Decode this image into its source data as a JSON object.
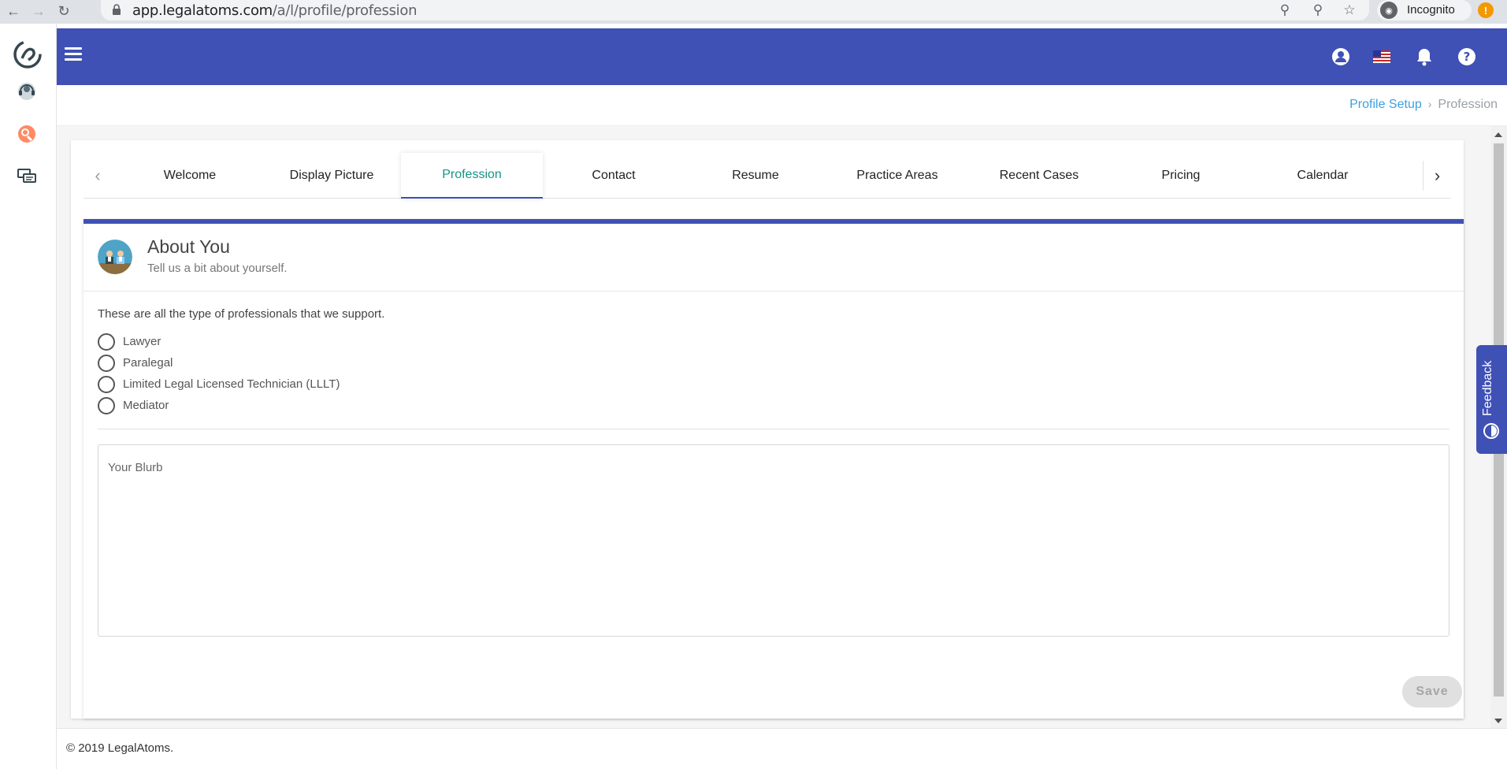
{
  "browser": {
    "url_host": "app.legalatoms.com",
    "url_path": "/a/l/profile/profession",
    "incognito_label": "Incognito",
    "update_badge": "!"
  },
  "sidebar": {
    "items": [
      {
        "icon": "support-agent-icon"
      },
      {
        "icon": "search-profile-icon"
      },
      {
        "icon": "chat-bubbles-icon"
      }
    ]
  },
  "appbar": {
    "color": "#3f51b5",
    "icons": [
      "account-icon",
      "us-flag-icon",
      "bell-icon",
      "help-icon"
    ]
  },
  "breadcrumb": {
    "parent": "Profile Setup",
    "separator": "›",
    "current": "Profession"
  },
  "tabs": {
    "items": [
      "Welcome",
      "Display Picture",
      "Profession",
      "Contact",
      "Resume",
      "Practice Areas",
      "Recent Cases",
      "Pricing",
      "Calendar"
    ],
    "active": "Profession"
  },
  "panel": {
    "title": "About You",
    "subtitle": "Tell us a bit about yourself.",
    "intro": "These are all the type of professionals that we support.",
    "options": [
      "Lawyer",
      "Paralegal",
      "Limited Legal Licensed Technician (LLLT)",
      "Mediator"
    ],
    "blurb_placeholder": "Your Blurb",
    "save_label": "Save"
  },
  "feedback": {
    "label": "Feedback"
  },
  "footer": {
    "copyright": "© 2019 LegalAtoms."
  },
  "colors": {
    "primary": "#3f51b5",
    "active_tab_text": "#159488",
    "link": "#3aa1e3"
  }
}
